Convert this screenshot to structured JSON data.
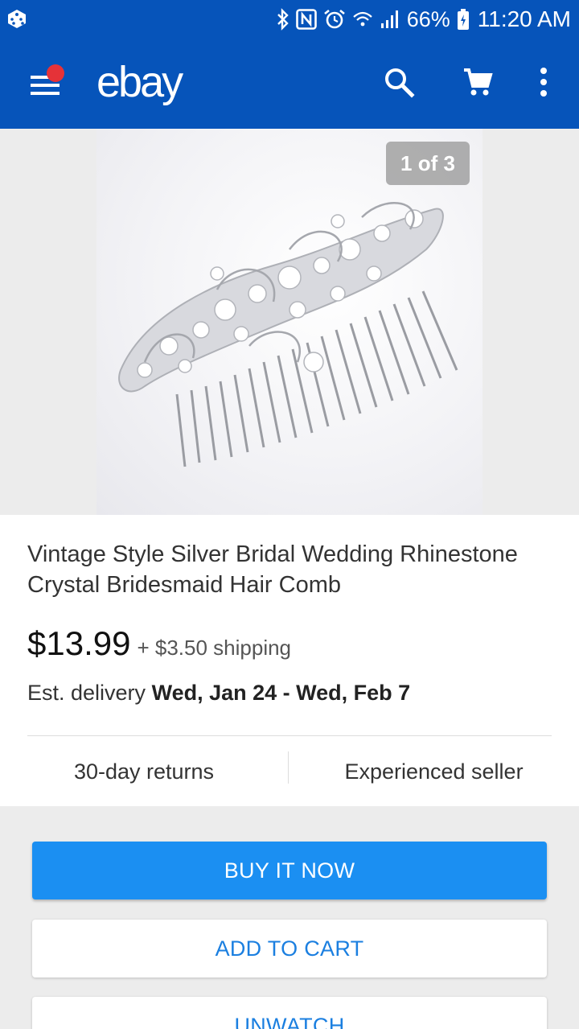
{
  "status_bar": {
    "battery_pct": "66%",
    "time": "11:20 AM"
  },
  "app_bar": {
    "logo": "ebay",
    "brand_color": "#0654ba",
    "notification_dot_color": "#e53238"
  },
  "gallery": {
    "counter": "1 of 3"
  },
  "product": {
    "title": "Vintage Style Silver Bridal Wedding Rhinestone Crystal Bridesmaid Hair Comb",
    "price": "$13.99",
    "shipping": "+ $3.50 shipping",
    "delivery_prefix": "Est. delivery",
    "delivery_dates": "Wed, Jan 24 - Wed, Feb 7",
    "badges": {
      "returns": "30-day returns",
      "seller": "Experienced seller"
    }
  },
  "actions": {
    "buy_now": "BUY IT NOW",
    "add_to_cart": "ADD TO CART",
    "unwatch": "UNWATCH",
    "primary_color": "#1b8ff2"
  },
  "icons": [
    "dice-icon",
    "bluetooth-icon",
    "nfc-icon",
    "alarm-icon",
    "wifi-icon",
    "signal-icon",
    "battery-icon",
    "menu-icon",
    "search-icon",
    "cart-icon",
    "more-vert-icon"
  ]
}
